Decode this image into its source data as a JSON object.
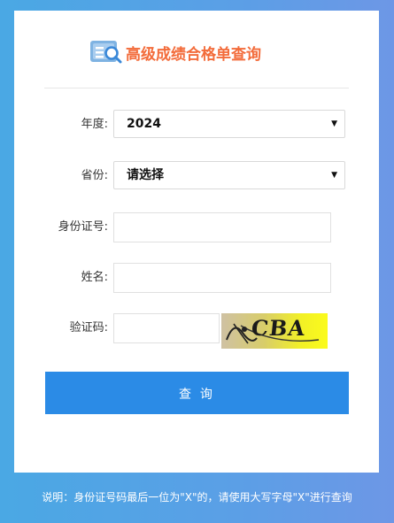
{
  "header": {
    "title": "高级成绩合格单查询"
  },
  "form": {
    "year_label": "年度:",
    "year_value": "2024",
    "province_label": "省份:",
    "province_value": "请选择",
    "id_label": "身份证号:",
    "id_value": "",
    "name_label": "姓名:",
    "name_value": "",
    "captcha_label": "验证码:",
    "captcha_value": "",
    "captcha_image_text": "CBA",
    "submit_label": "查 询"
  },
  "footer": {
    "note": "说明：身份证号码最后一位为\"X\"的，请使用大写字母\"X\"进行查询"
  },
  "colors": {
    "title": "#f36c3b",
    "button": "#2b8be6",
    "background": "#4aa8e4"
  },
  "icons": {
    "logo": "search-document-icon",
    "dropdown": "caret-down-icon"
  }
}
